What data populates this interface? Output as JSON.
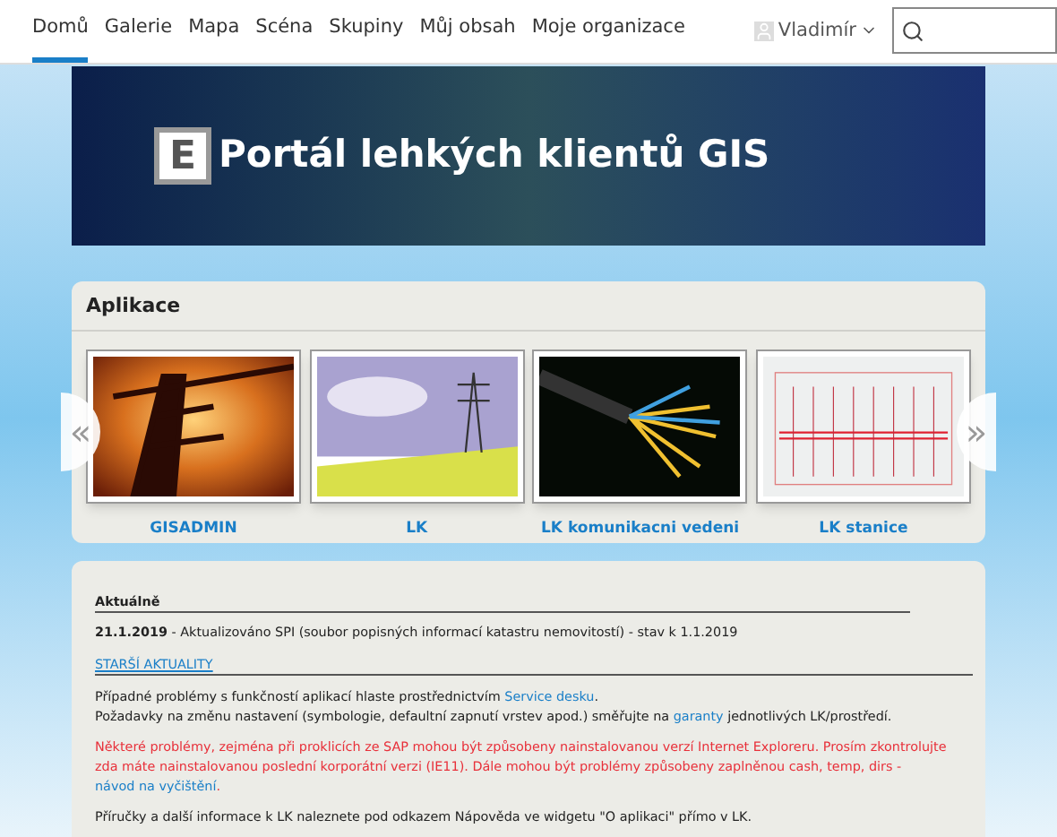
{
  "nav": {
    "items": [
      {
        "label": "Domů",
        "selected": true
      },
      {
        "label": "Galerie",
        "selected": false
      },
      {
        "label": "Mapa",
        "selected": false
      },
      {
        "label": "Scéna",
        "selected": false
      },
      {
        "label": "Skupiny",
        "selected": false
      },
      {
        "label": "Můj obsah",
        "selected": false
      },
      {
        "label": "Moje organizace",
        "selected": false
      }
    ],
    "user": "Vladimír"
  },
  "banner": {
    "logo": "E",
    "title": "Portál lehkých klientů GIS"
  },
  "apps": {
    "title": "Aplikace",
    "prev": "«",
    "next": "»",
    "items": [
      {
        "label": "GISADMIN",
        "kind": "sunset"
      },
      {
        "label": "LK",
        "kind": "field"
      },
      {
        "label": "LK komunikacni vedeni",
        "kind": "fiber"
      },
      {
        "label": "LK stanice",
        "kind": "schema"
      }
    ]
  },
  "news": {
    "heading": "Aktuálně",
    "entry": {
      "date": "21.1.2019",
      "text": " - Aktualizováno SPI (soubor popisných informací katastru nemovitostí) - stav k 1.1.2019"
    },
    "older": "STARŠÍ AKTUALITY",
    "paragraphs": [
      {
        "kind": "normal",
        "lines": [
          [
            {
              "kind": "text",
              "text": "Případné problémy s funkčností aplikací hlaste prostřednictvím "
            },
            {
              "kind": "link",
              "text": "Service desku"
            },
            {
              "kind": "text",
              "text": "."
            }
          ],
          [
            {
              "kind": "text",
              "text": "Požadavky na změnu nastavení (symbologie, defaultní zapnutí vrstev apod.) směřujte na "
            },
            {
              "kind": "link",
              "text": "garanty"
            },
            {
              "kind": "text",
              "text": " jednotlivých LK/prostředí."
            }
          ]
        ]
      },
      {
        "kind": "warning",
        "lines": [
          [
            {
              "kind": "text",
              "text": "Některé problémy, zejména při proklicích ze SAP mohou být způsobeny nainstalovanou verzí Internet Exploreru. Prosím zkontrolujte zda máte nainstalovanou poslední korporátní verzi (IE11). Dále mohou být problémy způsobeny zaplněnou cash, temp, dirs - "
            },
            {
              "kind": "link",
              "text": "návod na vyčištění"
            },
            {
              "kind": "text",
              "text": "."
            }
          ]
        ]
      },
      {
        "kind": "normal",
        "lines": [
          [
            {
              "kind": "text",
              "text": "Příručky a další informace k LK naleznete pod odkazem Nápověda ve widgetu \"O aplikaci\" přímo v LK."
            }
          ]
        ]
      }
    ]
  }
}
